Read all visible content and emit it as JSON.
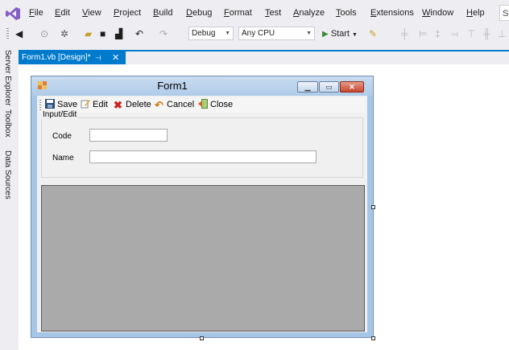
{
  "menu": {
    "items": [
      "File",
      "Edit",
      "View",
      "Project",
      "Build",
      "Debug",
      "Format",
      "Test",
      "Analyze",
      "Tools",
      "Extensions",
      "Window",
      "Help"
    ],
    "search_label": "Se"
  },
  "toolbar": {
    "config": "Debug",
    "platform": "Any CPU",
    "start_label": "Start"
  },
  "document_tab": {
    "title": "Form1.vb [Design]*",
    "pin": "⊣",
    "close": "✕"
  },
  "side_tabs": [
    "Server Explorer",
    "Toolbox",
    "Data Sources"
  ],
  "form": {
    "title": "Form1",
    "toolstrip": [
      "Save",
      "Edit",
      "Delete",
      "Cancel",
      "Close"
    ],
    "group_title": "Input/Edit",
    "code_label": "Code",
    "name_label": "Name",
    "code_value": "",
    "name_value": ""
  },
  "colors": {
    "accent": "#007acc",
    "grid_background": "#aaaaaa",
    "delete_icon": "#cc2222",
    "start_icon": "#388a34"
  }
}
